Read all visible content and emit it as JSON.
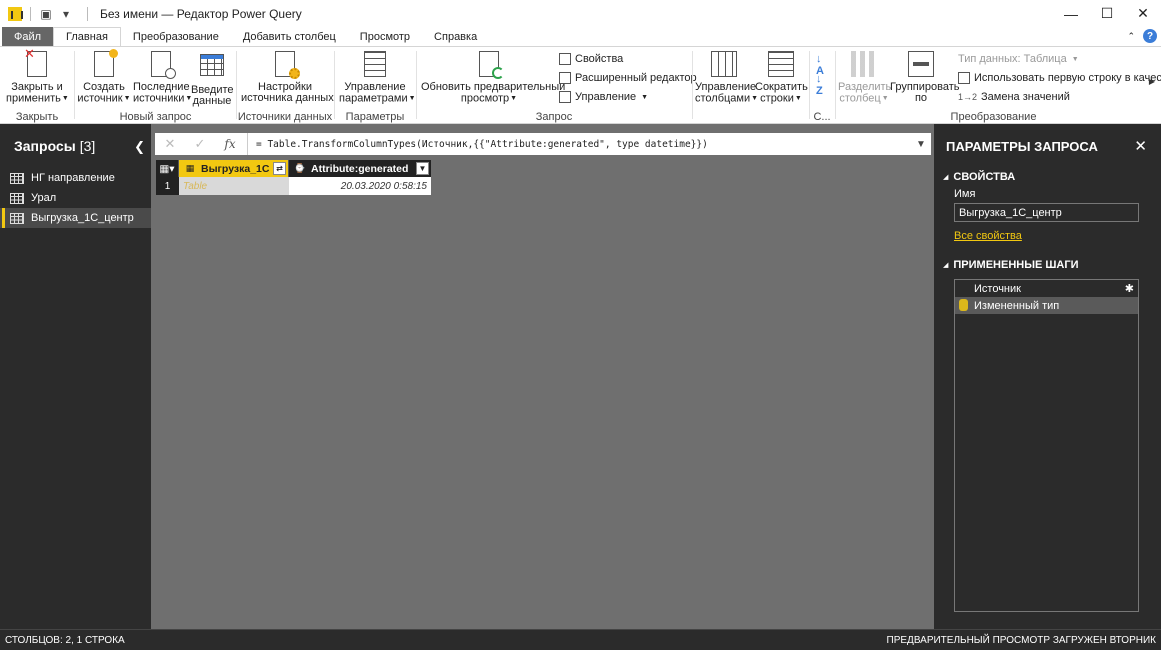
{
  "window": {
    "title": "Без имени — Редактор Power Query",
    "minimize": "—",
    "maximize": "☐",
    "close": "✕"
  },
  "tabs": [
    {
      "label": "Файл"
    },
    {
      "label": "Главная"
    },
    {
      "label": "Преобразование"
    },
    {
      "label": "Добавить столбец"
    },
    {
      "label": "Просмотр"
    },
    {
      "label": "Справка"
    }
  ],
  "ribbon": {
    "close_apply": "Закрыть и",
    "close_apply2": "применить",
    "group_close": "Закрыть",
    "new_source": "Создать",
    "new_source2": "источник",
    "recent_sources": "Последние",
    "recent_sources2": "источники",
    "enter_data": "Введите",
    "enter_data2": "данные",
    "group_new_query": "Новый запрос",
    "source_settings": "Настройки",
    "source_settings2": "источника данных",
    "group_sources": "Источники данных",
    "manage_params": "Управление",
    "manage_params2": "параметрами",
    "group_params": "Параметры",
    "refresh_preview": "Обновить предварительный",
    "refresh_preview2": "просмотр",
    "properties": "Свойства",
    "advanced_editor": "Расширенный редактор",
    "manage": "Управление",
    "group_query": "Запрос",
    "manage_columns": "Управление",
    "manage_columns2": "столбцами",
    "reduce_rows": "Сократить",
    "reduce_rows2": "строки",
    "group_sort": "С...",
    "split_column": "Разделить",
    "split_column2": "столбец",
    "group_by": "Группировать",
    "group_by2": "по",
    "data_type": "Тип данных: Таблица",
    "first_row_headers": "Использовать первую строку в качестве",
    "replace_values": "Замена значений",
    "group_transform": "Преобразование"
  },
  "queries_panel": {
    "title": "Запросы",
    "count": "[3]",
    "items": [
      {
        "label": "НГ направление"
      },
      {
        "label": "Урал"
      },
      {
        "label": "Выгрузка_1С_центр"
      }
    ]
  },
  "formula_bar": {
    "cancel": "✕",
    "confirm": "✓",
    "fx": "fx",
    "formula": "= Table.TransformColumnTypes(Источник,{{\"Attribute:generated\", type datetime}})"
  },
  "grid": {
    "columns": [
      {
        "name": "Выгрузка_1С"
      },
      {
        "name": "Attribute:generated"
      }
    ],
    "rows": [
      {
        "num": "1",
        "cells": [
          "Table",
          "20.03.2020 0:58:15"
        ]
      }
    ]
  },
  "settings_panel": {
    "title": "ПАРАМЕТРЫ ЗАПРОСА",
    "properties_header": "СВОЙСТВА",
    "name_label": "Имя",
    "name_value": "Выгрузка_1С_центр",
    "all_properties": "Все свойства",
    "steps_header": "ПРИМЕНЕННЫЕ ШАГИ",
    "steps": [
      {
        "label": "Источник"
      },
      {
        "label": "Измененный тип"
      }
    ]
  },
  "status": {
    "left": "СТОЛБЦОВ: 2, 1 СТРОКА",
    "right": "ПРЕДВАРИТЕЛЬНЫЙ ПРОСМОТР ЗАГРУЖЕН ВТОРНИК"
  },
  "colors": {
    "accent": "#f2c811",
    "panel": "#2b2b2b",
    "canvas": "#6f6f6f"
  }
}
